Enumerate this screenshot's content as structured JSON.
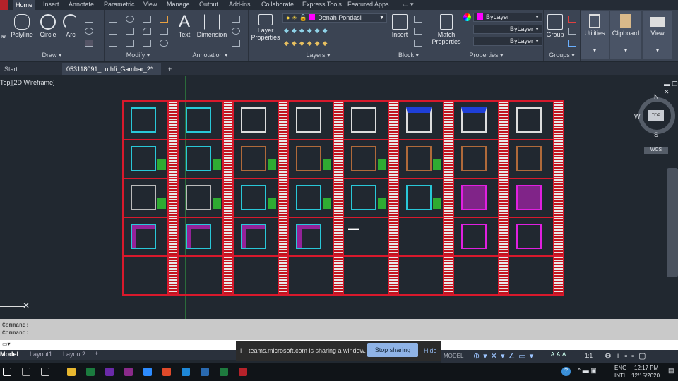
{
  "menu": {
    "tabs": [
      "Home",
      "Insert",
      "Annotate",
      "Parametric",
      "View",
      "Manage",
      "Output",
      "Add-ins",
      "Collaborate",
      "Express Tools",
      "Featured Apps"
    ]
  },
  "ribbon": {
    "draw": {
      "label": "Draw ▾",
      "line": "ne",
      "polyline": "Polyline",
      "circle": "Circle",
      "arc": "Arc"
    },
    "modify": {
      "label": "Modify ▾"
    },
    "annotation": {
      "label": "Annotation ▾",
      "text": "Text",
      "dimension": "Dimension"
    },
    "layers": {
      "label": "Layers ▾",
      "layer_properties_1": "Layer",
      "layer_properties_2": "Properties",
      "current_layer": "Denah Pondasi"
    },
    "block": {
      "label": "Block ▾",
      "insert": "Insert"
    },
    "properties": {
      "label": "Properties ▾",
      "match_1": "Match",
      "match_2": "Properties",
      "color": "ByLayer",
      "linetype": "ByLayer",
      "lineweight": "ByLayer",
      "color_value": "#ff00ff"
    },
    "groups": {
      "label": "Groups ▾",
      "group": "Group"
    },
    "utilities": "Utilities",
    "clipboard": "Clipboard",
    "view": "View"
  },
  "file_tabs": {
    "start": "Start",
    "active": "053118091_Luthfi_Gambar_2*",
    "close": "✕",
    "new": "+"
  },
  "viewport": {
    "label": "Top][2D Wireframe]",
    "viewcube": {
      "n": "N",
      "s": "S",
      "w": "W",
      "top": "TOP",
      "wcs": "WCS"
    }
  },
  "command": {
    "lines": [
      "Command:",
      "Command:"
    ]
  },
  "layout_tabs": [
    "Model",
    "Layout1",
    "Layout2",
    "+"
  ],
  "share": {
    "message": "teams.microsoft.com is sharing a window.",
    "stop": "Stop sharing",
    "hide": "Hide"
  },
  "status": {
    "model": "MODEL",
    "scale": "1:1"
  },
  "taskbar": {
    "lang1": "ENG",
    "lang2": "INTL",
    "time": "12:17 PM",
    "date": "12/15/2020"
  }
}
